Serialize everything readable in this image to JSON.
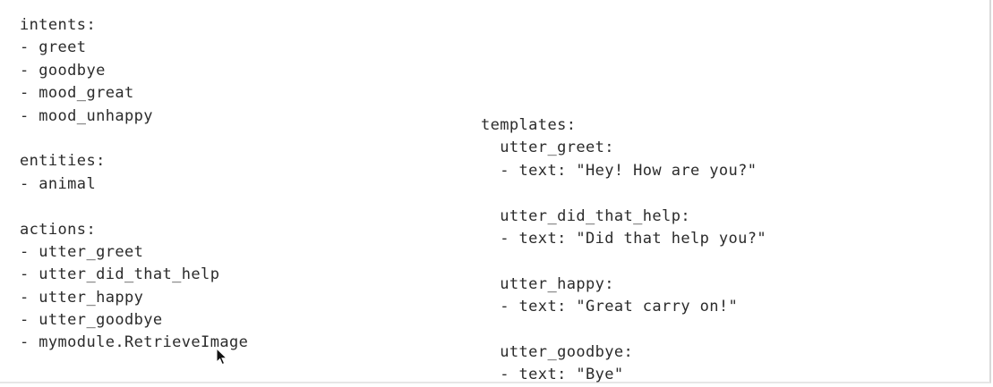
{
  "left_lines": [
    "intents:",
    "- greet",
    "- goodbye",
    "- mood_great",
    "- mood_unhappy",
    "",
    "entities:",
    "- animal",
    "",
    "actions:",
    "- utter_greet",
    "- utter_did_that_help",
    "- utter_happy",
    "- utter_goodbye",
    "- mymodule.RetrieveImage"
  ],
  "right_lines": [
    "templates:",
    "  utter_greet:",
    "  - text: \"Hey! How are you?\"",
    "",
    "  utter_did_that_help:",
    "  - text: \"Did that help you?\"",
    "",
    "  utter_happy:",
    "  - text: \"Great carry on!\"",
    "",
    "  utter_goodbye:",
    "  - text: \"Bye\""
  ]
}
